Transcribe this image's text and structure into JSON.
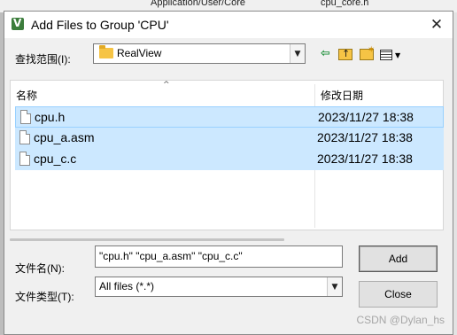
{
  "background": {
    "fragment_left": "Application/User/Core",
    "fragment_right": "cpu_core.h"
  },
  "dialog": {
    "title": "Add Files to Group 'CPU'",
    "close_glyph": "✕"
  },
  "lookin": {
    "label": "查找范围(I):",
    "value": "RealView",
    "icon": "folder-icon"
  },
  "toolbar": {
    "back_glyph": "⇦",
    "view_menu_glyph": "▼",
    "icons": [
      "back-icon",
      "up-folder-icon",
      "new-folder-icon",
      "view-menu-icon"
    ]
  },
  "filelist": {
    "columns": [
      "名称",
      "修改日期"
    ],
    "sort_glyph": "^",
    "rows": [
      {
        "name": "cpu.h",
        "date": "2023/11/27 18:38"
      },
      {
        "name": "cpu_a.asm",
        "date": "2023/11/27 18:38"
      },
      {
        "name": "cpu_c.c",
        "date": "2023/11/27 18:38"
      }
    ]
  },
  "filename": {
    "label": "文件名(N):",
    "value": "\"cpu.h\" \"cpu_a.asm\" \"cpu_c.c\""
  },
  "filetype": {
    "label": "文件类型(T):",
    "value": "All files (*.*)",
    "arrow_glyph": "▼"
  },
  "buttons": {
    "add": "Add",
    "close": "Close"
  },
  "watermark": "CSDN @Dylan_hs",
  "colors": {
    "selection": "#cce8ff",
    "selection_border": "#99d1ff",
    "dialog_bg": "#f0f0f0"
  }
}
